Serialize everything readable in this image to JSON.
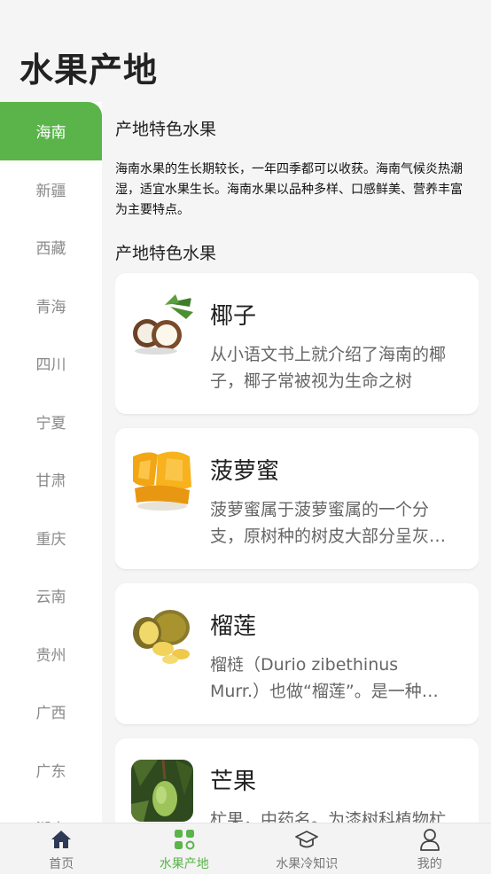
{
  "page": {
    "title": "水果产地"
  },
  "sidebar": {
    "items": [
      {
        "label": "海南",
        "active": true
      },
      {
        "label": "新疆"
      },
      {
        "label": "西藏"
      },
      {
        "label": "青海"
      },
      {
        "label": "四川"
      },
      {
        "label": "宁夏"
      },
      {
        "label": "甘肃"
      },
      {
        "label": "重庆"
      },
      {
        "label": "云南"
      },
      {
        "label": "贵州"
      },
      {
        "label": "广西"
      },
      {
        "label": "广东"
      },
      {
        "label": "湖南"
      }
    ]
  },
  "main": {
    "intro_title": "产地特色水果",
    "intro_text": "海南水果的生长期较长，一年四季都可以收获。海南气候炎热潮湿，适宜水果生长。海南水果以品种多样、口感鲜美、营养丰富为主要特点。",
    "list_title": "产地特色水果",
    "fruits": [
      {
        "name": "椰子",
        "desc": "从小语文书上就介绍了海南的椰子，椰子常被视为生命之树",
        "icon": "coconut-image"
      },
      {
        "name": "菠萝蜜",
        "desc": "菠萝蜜属于菠萝蜜属的一个分支，原树种的树皮大部分呈灰褐色",
        "icon": "jackfruit-image"
      },
      {
        "name": "榴莲",
        "desc": "榴梿（Durio zibethinus Murr.）也做“榴莲”。是一种热带水果",
        "icon": "durian-image"
      },
      {
        "name": "芒果",
        "desc": "杧果，中药名。为漆树科植物杧果的果实",
        "icon": "mango-image"
      }
    ]
  },
  "tabbar": {
    "tabs": [
      {
        "label": "首页",
        "icon": "home-icon"
      },
      {
        "label": "水果产地",
        "icon": "grid-icon",
        "active": true
      },
      {
        "label": "水果冷知识",
        "icon": "graduation-cap-icon"
      },
      {
        "label": "我的",
        "icon": "user-icon"
      }
    ]
  },
  "colors": {
    "accent": "#5ab44a",
    "inactive": "#8a8a8a",
    "background": "#f5f5f5"
  }
}
